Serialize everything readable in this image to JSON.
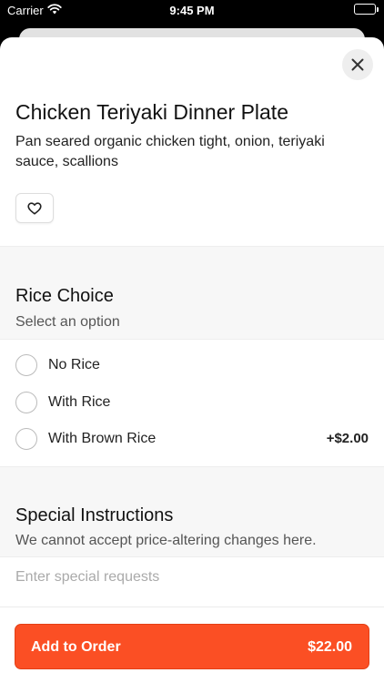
{
  "status_bar": {
    "carrier": "Carrier",
    "time": "9:45 PM",
    "icons": [
      "wifi-icon",
      "battery-icon"
    ]
  },
  "item": {
    "title": "Chicken Teriyaki Dinner Plate",
    "description": "Pan seared organic chicken tight, onion, teriyaki sauce, scallions",
    "close_icon": "close-icon",
    "favorite_icon": "heart-outline-icon"
  },
  "rice_choice": {
    "title": "Rice Choice",
    "subtitle": "Select an option",
    "options": [
      {
        "label": "No Rice",
        "price": "",
        "selected": false
      },
      {
        "label": "With Rice",
        "price": "",
        "selected": false
      },
      {
        "label": "With Brown Rice",
        "price": "+$2.00",
        "selected": false
      }
    ]
  },
  "special_instructions": {
    "title": "Special Instructions",
    "subtitle": "We cannot accept price-altering changes here.",
    "placeholder": "Enter special requests",
    "value": ""
  },
  "footer": {
    "add_label": "Add to Order",
    "price": "$22.00"
  },
  "colors": {
    "accent": "#fb4f24",
    "section_bg": "#f7f7f7",
    "text": "#111111"
  }
}
